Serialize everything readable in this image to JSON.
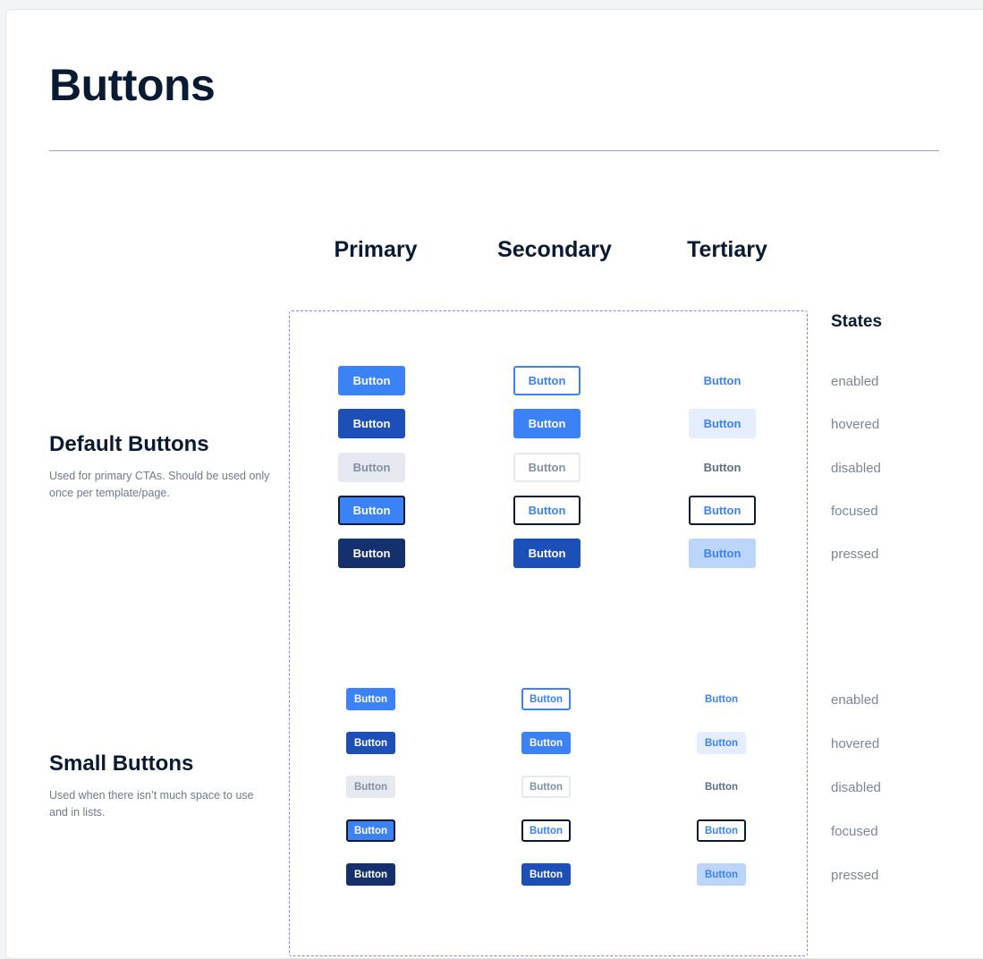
{
  "page": {
    "title": "Buttons"
  },
  "columns": {
    "primary": "Primary",
    "secondary": "Secondary",
    "tertiary": "Tertiary",
    "states": "States"
  },
  "default_section": {
    "title": "Default Buttons",
    "description": "Used for primary CTAs. Should be used only once per template/page."
  },
  "small_section": {
    "title": "Small Buttons",
    "description": "Used when there isn’t much space to use and in lists."
  },
  "button_label": "Button",
  "states": [
    "enabled",
    "hovered",
    "disabled",
    "focused",
    "pressed"
  ],
  "colors": {
    "primary": "#3b82f6",
    "primary_hover": "#1d4fb8",
    "primary_pressed": "#14316e",
    "disabled_bg": "#e6eaf0",
    "focus_ring": "#0b1a33",
    "tertiary_hover": "#e4eefe",
    "tertiary_pressed": "#bcd5fb",
    "frame_dashed": "#8b80ea"
  }
}
